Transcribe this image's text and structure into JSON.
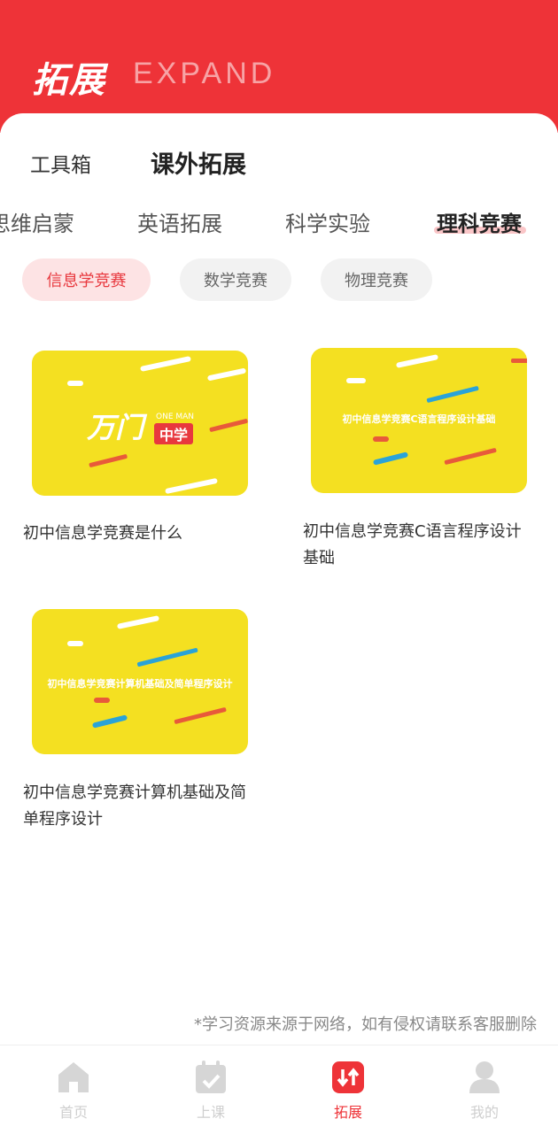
{
  "header": {
    "title": "拓展",
    "subtitle": "EXPAND"
  },
  "main_tabs": [
    {
      "label": "工具箱",
      "active": false
    },
    {
      "label": "课外拓展",
      "active": true
    }
  ],
  "sub_tabs": [
    {
      "label": "思维启蒙",
      "active": false
    },
    {
      "label": "英语拓展",
      "active": false
    },
    {
      "label": "科学实验",
      "active": false
    },
    {
      "label": "理科竞赛",
      "active": true
    }
  ],
  "chips": [
    {
      "label": "信息学竞赛",
      "active": true
    },
    {
      "label": "数学竞赛",
      "active": false
    },
    {
      "label": "物理竞赛",
      "active": false
    }
  ],
  "cards": [
    {
      "title": "初中信息学竞赛是什么",
      "thumb_text": "万门",
      "thumb_badge": "中学",
      "thumb_small": "ONE MAN"
    },
    {
      "title": "初中信息学竞赛C语言程序设计基础",
      "thumb_text": "初中信息学竞赛C语言程序设计基础"
    },
    {
      "title": "初中信息学竞赛计算机基础及简单程序设计",
      "thumb_text": "初中信息学竞赛计算机基础及简单程序设计"
    }
  ],
  "notice": "*学习资源来源于网络，如有侵权请联系客服删除",
  "tabbar": [
    {
      "label": "首页",
      "icon": "home-icon",
      "active": false
    },
    {
      "label": "上课",
      "icon": "calendar-check-icon",
      "active": false
    },
    {
      "label": "拓展",
      "icon": "expand-arrows-icon",
      "active": true
    },
    {
      "label": "我的",
      "icon": "user-icon",
      "active": false
    }
  ],
  "colors": {
    "brand_red": "#ee3338",
    "thumb_yellow": "#f4e021",
    "chip_active_bg": "#fde3e4"
  }
}
